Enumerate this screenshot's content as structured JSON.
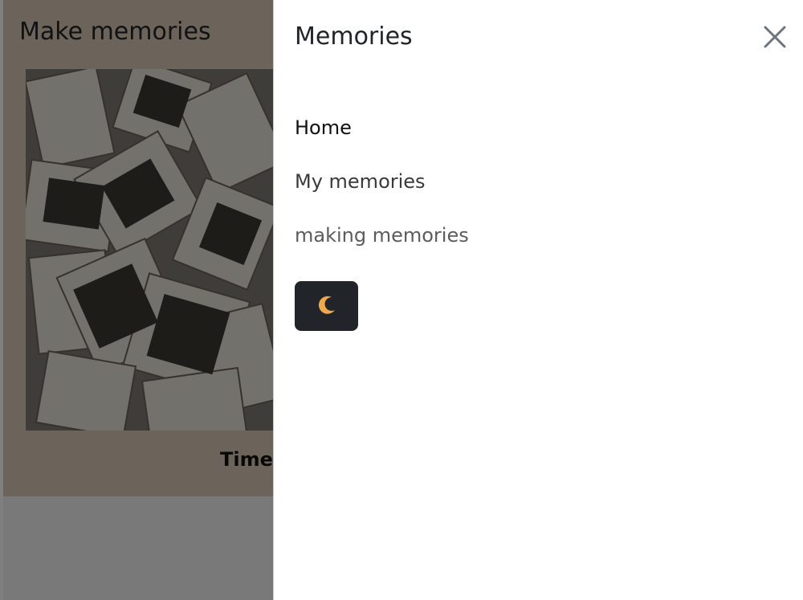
{
  "background": {
    "title": "Make memories",
    "caption": "Time"
  },
  "offcanvas": {
    "title": "Memories",
    "close_icon": "close-icon",
    "nav": [
      {
        "label": "Home"
      },
      {
        "label": "My memories"
      },
      {
        "label": "making memories"
      }
    ],
    "theme_toggle_icon": "moon-icon"
  },
  "colors": {
    "header_bg": "#d8c8b4",
    "theme_button_bg": "#212529",
    "moon": "#f0a94a"
  }
}
